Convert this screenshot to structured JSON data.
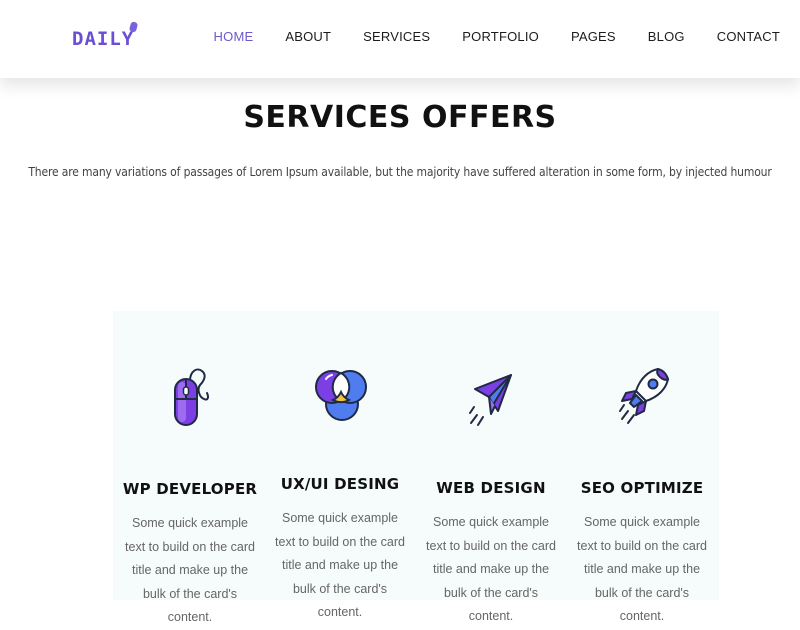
{
  "header": {
    "logo_text": "DAILY",
    "nav": [
      {
        "label": "HOME",
        "active": true
      },
      {
        "label": "ABOUT",
        "active": false
      },
      {
        "label": "SERVICES",
        "active": false
      },
      {
        "label": "PORTFOLIO",
        "active": false
      },
      {
        "label": "PAGES",
        "active": false
      },
      {
        "label": "BLOG",
        "active": false
      },
      {
        "label": "CONTACT",
        "active": false
      }
    ]
  },
  "section": {
    "title": "SERVICES OFFERS",
    "description": "There are many variations of passages of Lorem Ipsum available, but the majority have suffered alteration in some form, by injected humour"
  },
  "services": [
    {
      "title": "WP DEVELOPER",
      "text": "Some quick example text to build on the card title and make up the bulk of the card's content.",
      "icon": "mouse-icon"
    },
    {
      "title": "UX/UI DESING",
      "text": "Some quick example text to build on the card title and make up the bulk of the card's content.",
      "icon": "color-circles-icon"
    },
    {
      "title": "WEB DESIGN",
      "text": "Some quick example text to build on the card title and make up the bulk of the card's content.",
      "icon": "paper-plane-icon"
    },
    {
      "title": "SEO OPTIMIZE",
      "text": "Some quick example text to build on the card title and make up the bulk of the card's content.",
      "icon": "rocket-icon"
    }
  ],
  "colors": {
    "accent": "#6a5acd",
    "icon_purple": "#7b3fe4",
    "icon_blue": "#4f7df0",
    "icon_yellow": "#f3c53c",
    "icon_outline": "#1f2a44",
    "panel_bg": "#f6fbfb"
  }
}
